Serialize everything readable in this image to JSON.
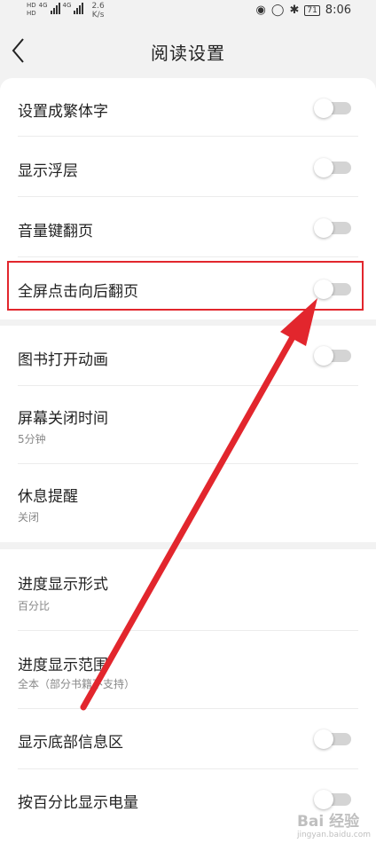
{
  "status_bar": {
    "hd1": "HD",
    "hd2": "HD",
    "net1": "4G",
    "net2": "4G",
    "speed_value": "2.6",
    "speed_unit": "K/s",
    "battery": "71",
    "time": "8:06"
  },
  "header": {
    "title": "阅读设置"
  },
  "settings": [
    {
      "label": "设置成繁体字",
      "toggle": "off"
    },
    {
      "label": "显示浮层",
      "toggle": "off"
    },
    {
      "label": "音量键翻页",
      "toggle": "off"
    },
    {
      "label": "全屏点击向后翻页",
      "toggle": "off"
    },
    {
      "label": "图书打开动画",
      "toggle": "off"
    },
    {
      "label": "屏幕关闭时间",
      "value": "5分钟"
    },
    {
      "label": "休息提醒",
      "value": "关闭"
    },
    {
      "label": "进度显示形式",
      "value": "百分比"
    },
    {
      "label": "进度显示范围",
      "value": "全本（部分书籍不支持）"
    },
    {
      "label": "显示底部信息区",
      "toggle": "off"
    },
    {
      "label": "按百分比显示电量",
      "toggle": "off"
    }
  ],
  "watermark": {
    "brand": "Bai 经验",
    "url": "jingyan.baidu.com"
  },
  "colors": {
    "highlight": "#e2262d",
    "toggle_off": "#d4d4d4"
  }
}
